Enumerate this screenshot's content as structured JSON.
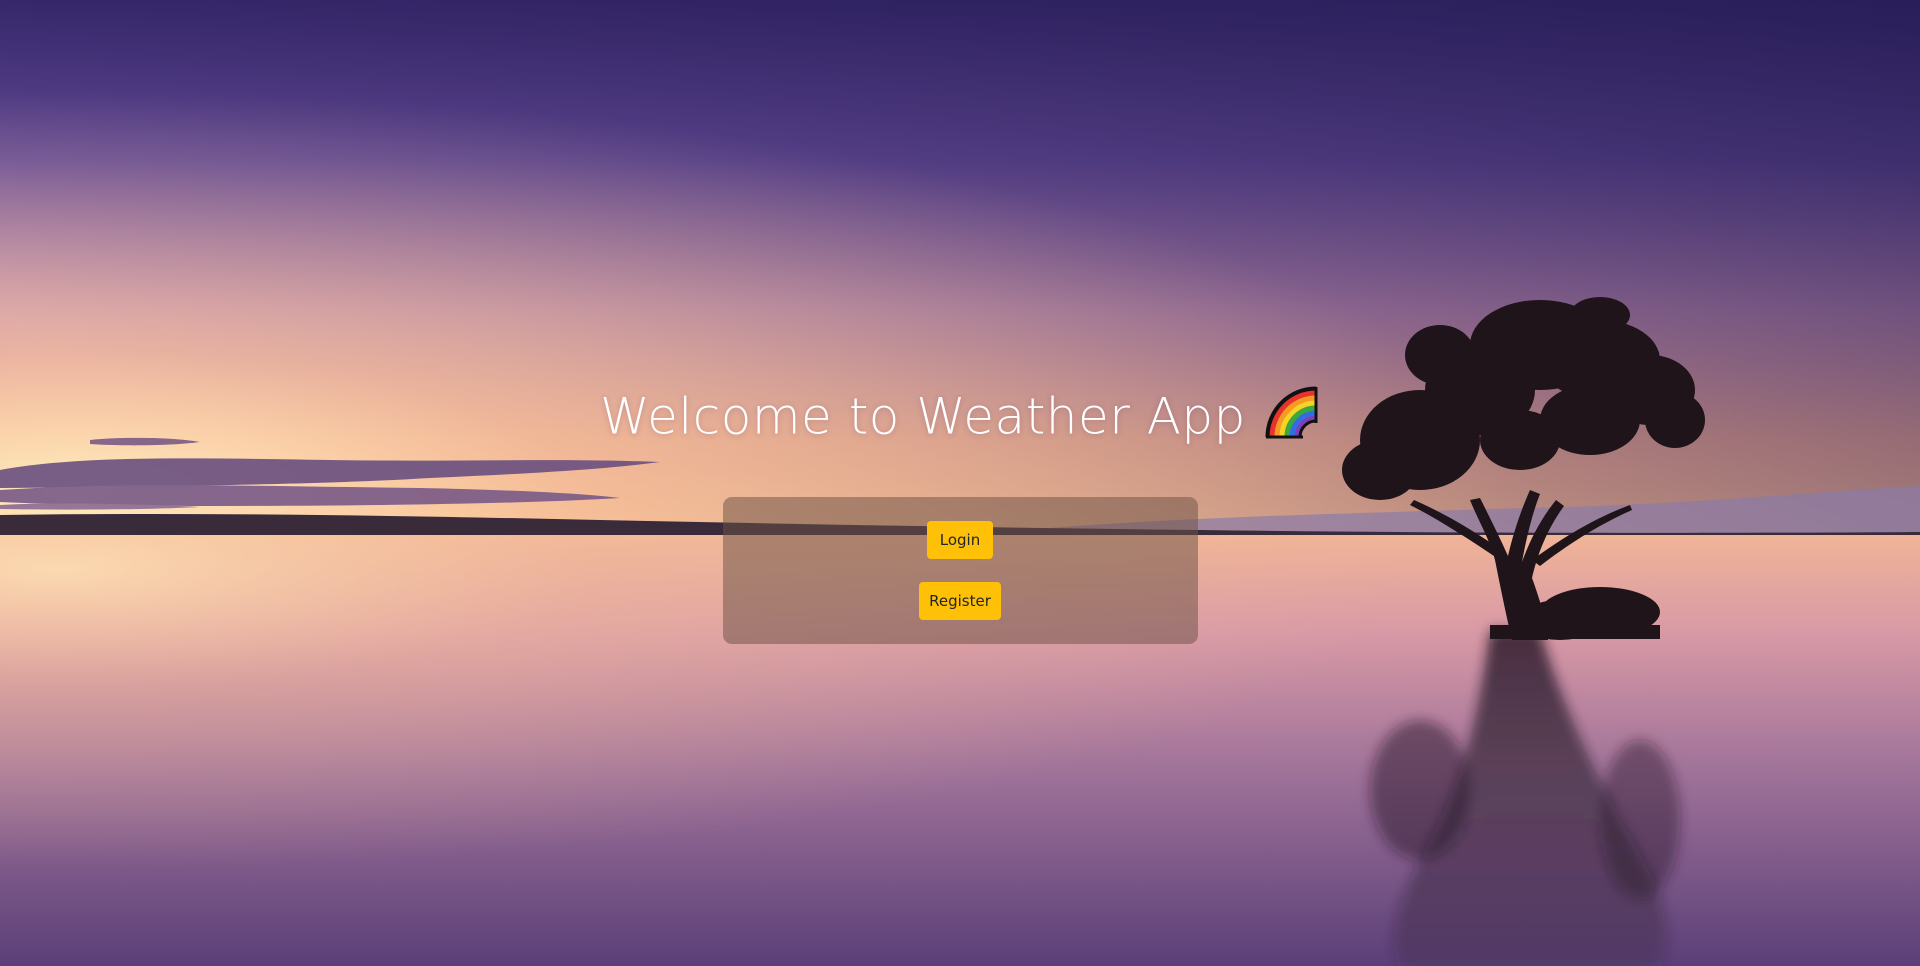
{
  "page": {
    "title": "Welcome to Weather App",
    "title_icon": "rainbow-icon"
  },
  "auth_panel": {
    "login_label": "Login",
    "register_label": "Register"
  },
  "colors": {
    "button_bg": "#ffc107",
    "button_text": "#212529",
    "title_text": "#ffffff",
    "panel_bg": "rgba(110,82,70,0.52)"
  }
}
